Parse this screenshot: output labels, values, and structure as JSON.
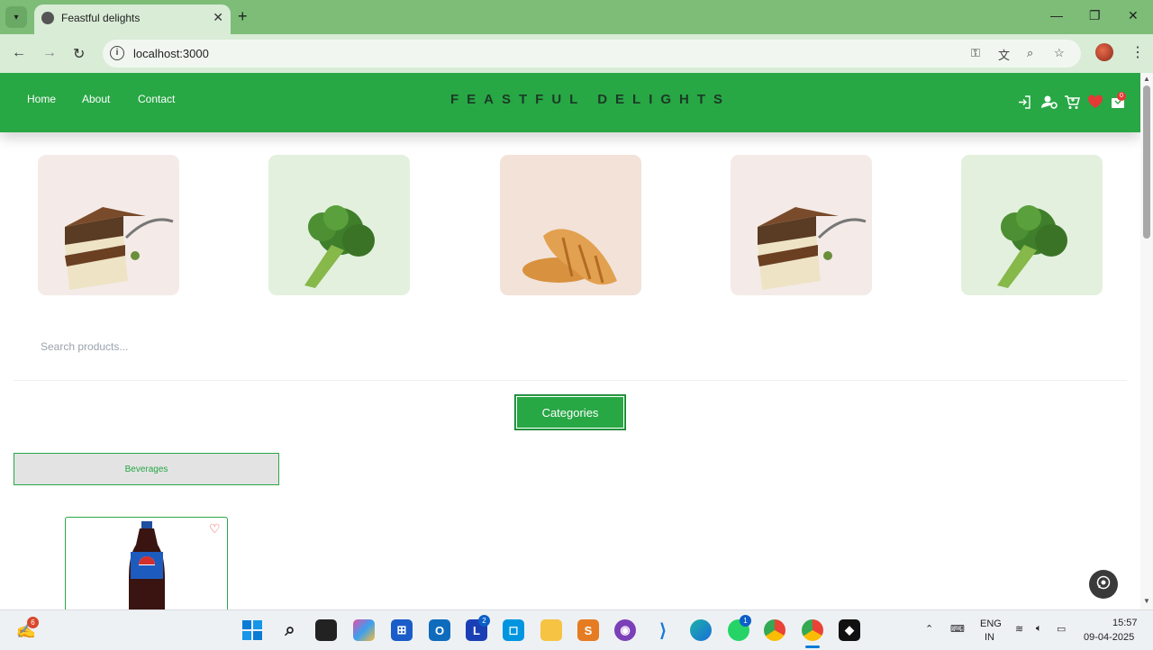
{
  "browser": {
    "tab_title": "Feastful delights",
    "url": "localhost:3000"
  },
  "site": {
    "nav": [
      "Home",
      "About",
      "Contact"
    ],
    "brand": "FEASTFUL DELIGHTS",
    "cart_count": "0",
    "header_icons": [
      "login-icon",
      "user-settings-icon",
      "cart-icon",
      "heart-icon",
      "bag-icon"
    ],
    "carousel": [
      "cake",
      "broccoli",
      "croissant",
      "cake",
      "broccoli"
    ],
    "search_placeholder": "Search products...",
    "categories_label": "Categories",
    "category_filter": "Beverages",
    "colors": {
      "brand": "#28a745",
      "heart": "#e53935"
    }
  },
  "taskbar": {
    "lang_1": "ENG",
    "lang_2": "IN",
    "time": "15:57",
    "date": "09-04-2025",
    "badges": {
      "app": "6",
      "teams": "2",
      "whatsapp": "1"
    }
  }
}
